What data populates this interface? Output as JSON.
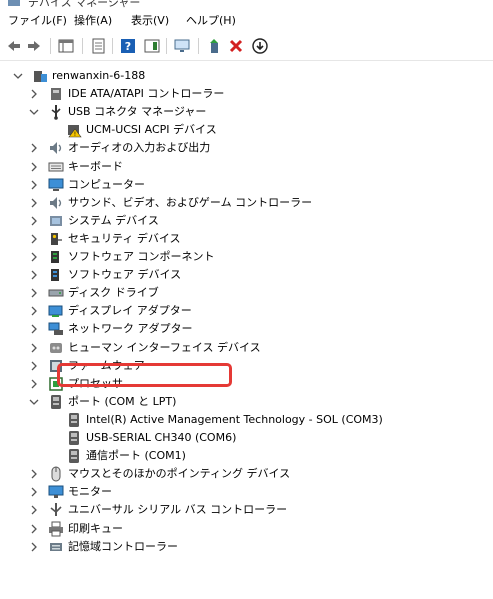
{
  "window": {
    "title": "デバイス マネージャー"
  },
  "menu": [
    {
      "label": "ファイル(F)"
    },
    {
      "label": "操作(A)"
    },
    {
      "label": "表示(V)"
    },
    {
      "label": "ヘルプ(H)"
    }
  ],
  "toolbar": [
    {
      "icon": "back-arrow-icon"
    },
    {
      "icon": "forward-arrow-icon"
    },
    {
      "icon": "properties-grid-icon"
    },
    {
      "icon": "document-icon"
    },
    {
      "icon": "help-icon"
    },
    {
      "icon": "action-pane-icon"
    },
    {
      "icon": "monitor-scan-icon"
    },
    {
      "icon": "update-driver-icon"
    },
    {
      "icon": "uninstall-x-icon"
    },
    {
      "icon": "download-circle-icon"
    }
  ],
  "tree": {
    "root": {
      "label": "renwanxin-6-188"
    },
    "items": [
      {
        "label": "IDE ATA/ATAPI コントローラー",
        "icon": "ide-controller-icon",
        "expanded": false
      },
      {
        "label": "USB コネクタ マネージャー",
        "icon": "usb-connector-icon",
        "expanded": true
      },
      {
        "label": "UCM-UCSI ACPI デバイス",
        "icon": "warning-icon",
        "child": true
      },
      {
        "label": "オーディオの入力および出力",
        "icon": "speaker-icon",
        "expanded": false
      },
      {
        "label": "キーボード",
        "icon": "keyboard-icon",
        "expanded": false
      },
      {
        "label": "コンピューター",
        "icon": "computer-icon",
        "expanded": false
      },
      {
        "label": "サウンド、ビデオ、およびゲーム コントローラー",
        "icon": "speaker-icon",
        "expanded": false
      },
      {
        "label": "システム デバイス",
        "icon": "system-folder-icon",
        "expanded": false
      },
      {
        "label": "セキュリティ デバイス",
        "icon": "security-key-icon",
        "expanded": false
      },
      {
        "label": "ソフトウェア コンポーネント",
        "icon": "software-component-icon",
        "expanded": false
      },
      {
        "label": "ソフトウェア デバイス",
        "icon": "software-device-icon",
        "expanded": false
      },
      {
        "label": "ディスク ドライブ",
        "icon": "disk-drive-icon",
        "expanded": false
      },
      {
        "label": "ディスプレイ アダプター",
        "icon": "display-adapter-icon",
        "expanded": false
      },
      {
        "label": "ネットワーク アダプター",
        "icon": "network-adapter-icon",
        "expanded": false
      },
      {
        "label": "ヒューマン インターフェイス デバイス",
        "icon": "hid-icon",
        "expanded": false
      },
      {
        "label": "ファームウェア",
        "icon": "firmware-icon",
        "expanded": false
      },
      {
        "label": "プロセッサ",
        "icon": "processor-icon",
        "expanded": false
      },
      {
        "label": "ポート (COM と LPT)",
        "icon": "port-icon",
        "expanded": true
      },
      {
        "label": "Intel(R) Active Management Technology - SOL (COM3)",
        "icon": "port-icon",
        "child": true
      },
      {
        "label": "USB-SERIAL CH340 (COM6)",
        "icon": "port-icon",
        "child": true,
        "highlighted": true
      },
      {
        "label": "通信ポート (COM1)",
        "icon": "port-icon",
        "child": true
      },
      {
        "label": "マウスとそのほかのポインティング デバイス",
        "icon": "mouse-icon",
        "expanded": false
      },
      {
        "label": "モニター",
        "icon": "monitor-icon",
        "expanded": false
      },
      {
        "label": "ユニバーサル シリアル バス コントローラー",
        "icon": "usb-controller-icon",
        "expanded": false
      },
      {
        "label": "印刷キュー",
        "icon": "printer-icon",
        "expanded": false
      },
      {
        "label": "記憶域コントローラー",
        "icon": "storage-controller-icon",
        "expanded": false
      }
    ]
  },
  "colors": {
    "highlight": "#e53935",
    "accent": "#1a5fb4"
  }
}
